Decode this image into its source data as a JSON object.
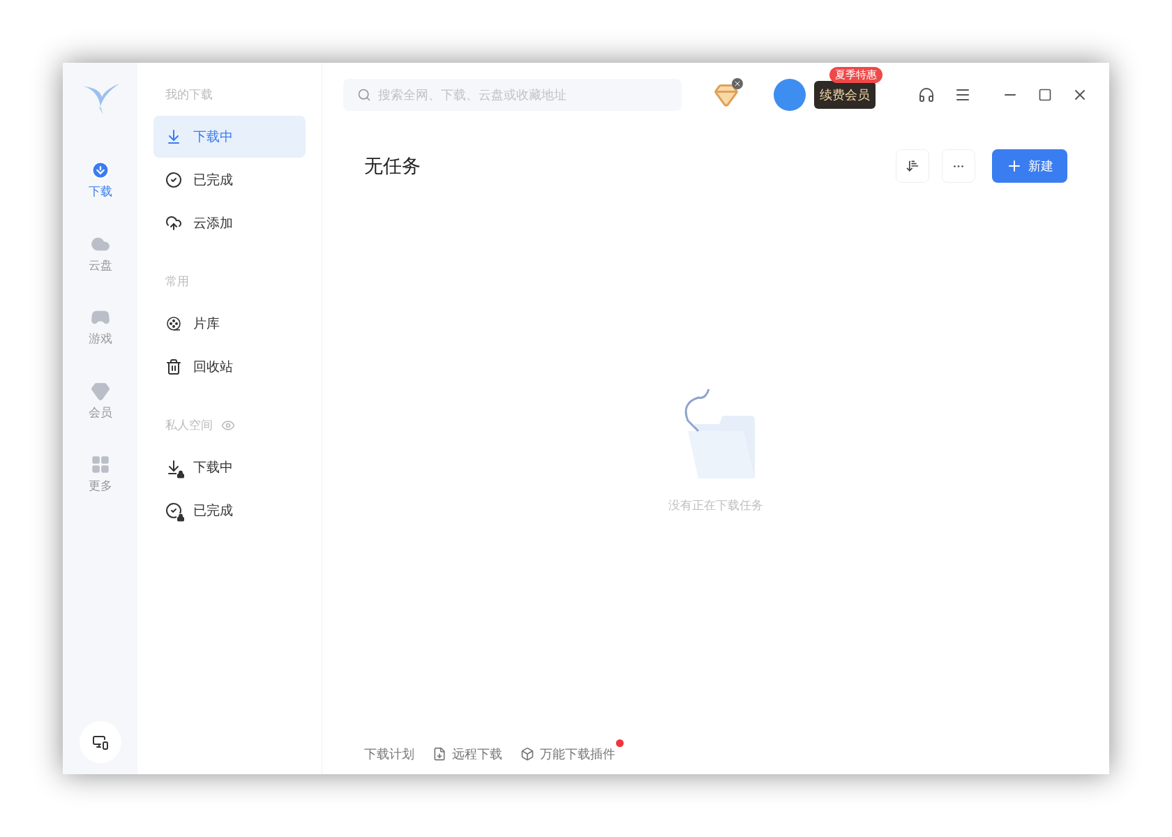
{
  "rail": [
    {
      "label": "下载",
      "selected": true
    },
    {
      "label": "云盘",
      "selected": false
    },
    {
      "label": "游戏",
      "selected": false
    },
    {
      "label": "会员",
      "selected": false
    },
    {
      "label": "更多",
      "selected": false
    }
  ],
  "sidebar": {
    "groups": [
      {
        "title": "我的下载",
        "items": [
          {
            "label": "下载中",
            "selected": true
          },
          {
            "label": "已完成",
            "selected": false
          },
          {
            "label": "云添加",
            "selected": false
          }
        ]
      },
      {
        "title": "常用",
        "items": [
          {
            "label": "片库",
            "selected": false
          },
          {
            "label": "回收站",
            "selected": false
          }
        ]
      },
      {
        "title": "私人空间",
        "items": [
          {
            "label": "下载中",
            "selected": false
          },
          {
            "label": "已完成",
            "selected": false
          }
        ]
      }
    ]
  },
  "search": {
    "placeholder": "搜索全网、下载、云盘或收藏地址"
  },
  "promo": {
    "badge": "夏季特惠",
    "button": "续费会员"
  },
  "header": {
    "title": "无任务",
    "new_button": "新建"
  },
  "empty": {
    "message": "没有正在下载任务"
  },
  "footer": [
    {
      "label": "下载计划",
      "dot": false
    },
    {
      "label": "远程下载",
      "dot": false
    },
    {
      "label": "万能下载插件",
      "dot": true
    }
  ]
}
